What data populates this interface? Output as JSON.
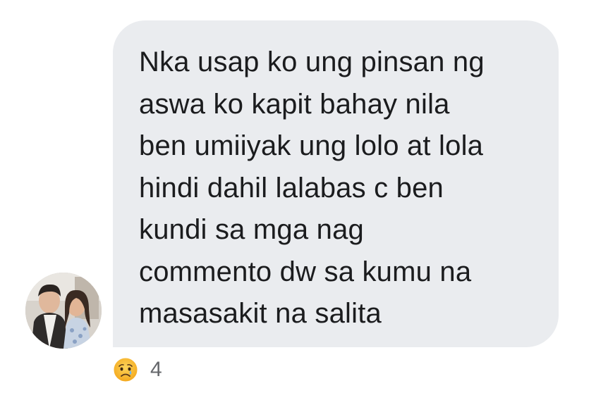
{
  "comment": {
    "text": "Nka usap ko ung pinsan ng\naswa ko kapit bahay nila\nben umiiyak ung lolo at lola\nhindi dahil lalabas  c ben\nkundi sa mga nag\ncommento dw sa kumu na\nmasasakit na salita"
  },
  "reaction": {
    "icon": "sad-face-icon",
    "count": "4"
  },
  "colors": {
    "bubble_background": "#eaecef",
    "text": "#1b1c1e",
    "count_text": "#65676b",
    "sad_emoji": "#f7b125"
  }
}
